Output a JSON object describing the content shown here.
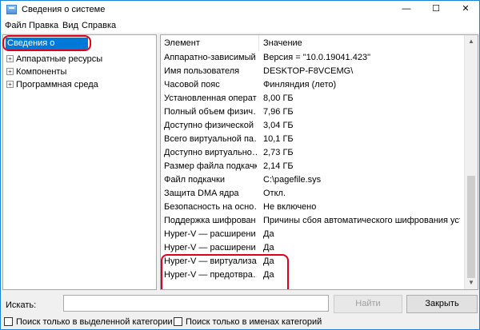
{
  "window": {
    "title": "Сведения о системе",
    "minimize": "—",
    "maximize": "☐",
    "close": "✕"
  },
  "menu": [
    "Файл",
    "Правка",
    "Вид",
    "Справка"
  ],
  "tree": {
    "root": "Сведения о системе",
    "children": [
      "Аппаратные ресурсы",
      "Компоненты",
      "Программная среда"
    ],
    "expander": "+"
  },
  "table": {
    "headers": [
      "Элемент",
      "Значение"
    ],
    "rows": [
      {
        "key": "Аппаратно-зависимый…",
        "value": "Версия = \"10.0.19041.423\""
      },
      {
        "key": "Имя пользователя",
        "value": "DESKTOP-F8VCEMG\\"
      },
      {
        "key": "Часовой пояс",
        "value": "Финляндия (лето)"
      },
      {
        "key": "Установленная операт…",
        "value": "8,00 ГБ"
      },
      {
        "key": "Полный объем физич…",
        "value": "7,96 ГБ"
      },
      {
        "key": "Доступно физической …",
        "value": "3,04 ГБ"
      },
      {
        "key": "Всего виртуальной па…",
        "value": "10,1 ГБ"
      },
      {
        "key": "Доступно виртуально…",
        "value": "2,73 ГБ"
      },
      {
        "key": "Размер файла подкачки",
        "value": "2,14 ГБ"
      },
      {
        "key": "Файл подкачки",
        "value": "C:\\pagefile.sys"
      },
      {
        "key": "Защита DMA ядра",
        "value": "Откл."
      },
      {
        "key": "Безопасность на осно…",
        "value": "Не включено"
      },
      {
        "key": "Поддержка шифрован…",
        "value": "Причины сбоя автоматического шифрования устро"
      },
      {
        "key": "Hyper-V — расширени…",
        "value": "Да"
      },
      {
        "key": "Hyper-V — расширени…",
        "value": "Да"
      },
      {
        "key": "Hyper-V — виртуализа…",
        "value": "Да"
      },
      {
        "key": "Hyper-V — предотвра…",
        "value": "Да"
      }
    ]
  },
  "search": {
    "label": "Искать:",
    "value": "",
    "find_button": "Найти",
    "close_button": "Закрыть",
    "option_selected_category": "Поиск только в выделенной категории",
    "option_category_names": "Поиск только в именах категорий"
  },
  "colors": {
    "selection": "#0078d7",
    "highlight_ring": "#e0001b",
    "window_border": "#1883d7"
  }
}
